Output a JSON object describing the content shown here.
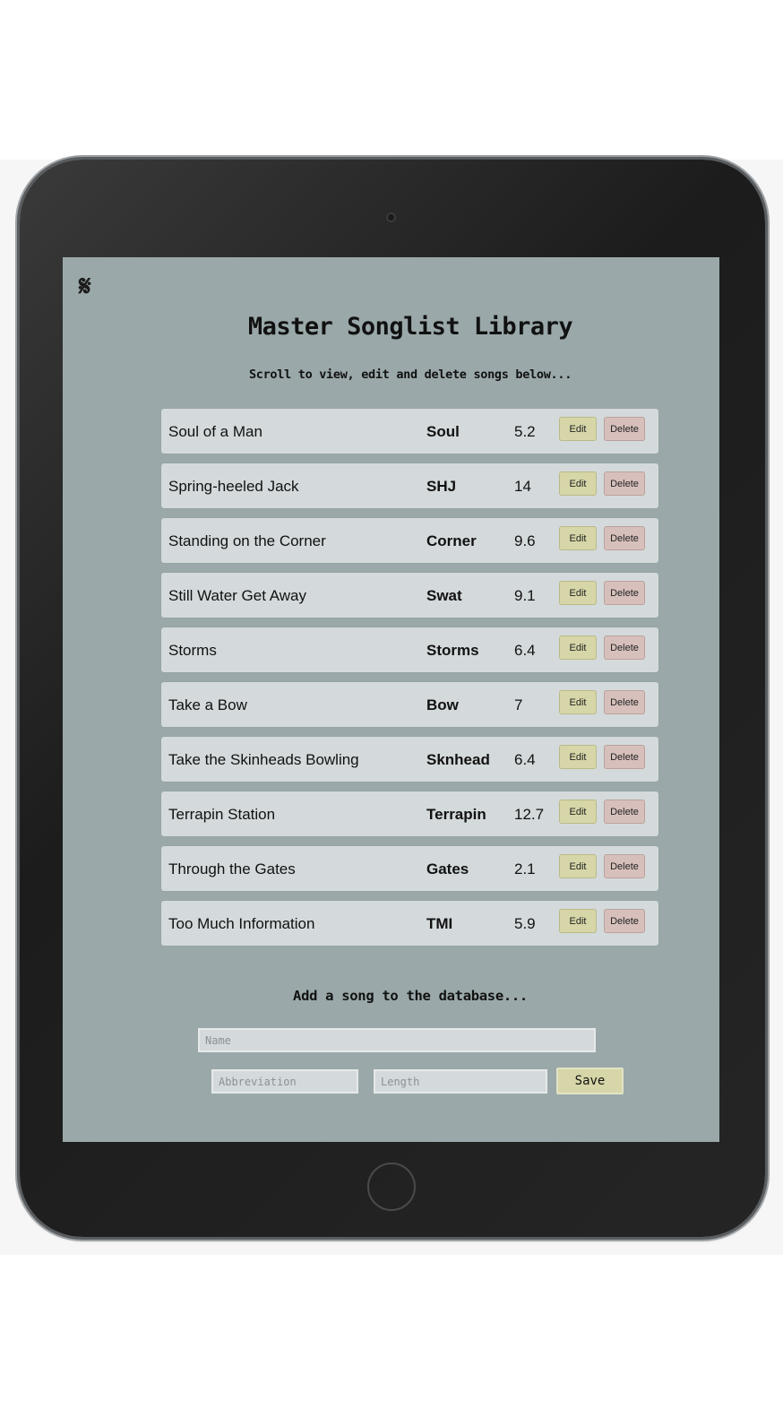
{
  "app": {
    "logo_glyph": "𝄋",
    "title": "Master Songlist Library",
    "subtitle": "Scroll to view, edit and delete songs below..."
  },
  "songs": [
    {
      "name": "Soul of a Man",
      "abbreviation": "Soul",
      "length": "5.2",
      "edit_label": "Edit",
      "delete_label": "Delete"
    },
    {
      "name": "Spring-heeled Jack",
      "abbreviation": "SHJ",
      "length": "14",
      "edit_label": "Edit",
      "delete_label": "Delete"
    },
    {
      "name": "Standing on the Corner",
      "abbreviation": "Corner",
      "length": "9.6",
      "edit_label": "Edit",
      "delete_label": "Delete"
    },
    {
      "name": "Still Water Get Away",
      "abbreviation": "Swat",
      "length": "9.1",
      "edit_label": "Edit",
      "delete_label": "Delete"
    },
    {
      "name": "Storms",
      "abbreviation": "Storms",
      "length": "6.4",
      "edit_label": "Edit",
      "delete_label": "Delete"
    },
    {
      "name": "Take a Bow",
      "abbreviation": "Bow",
      "length": "7",
      "edit_label": "Edit",
      "delete_label": "Delete"
    },
    {
      "name": "Take the Skinheads Bowling",
      "abbreviation": "Sknhead",
      "length": "6.4",
      "edit_label": "Edit",
      "delete_label": "Delete"
    },
    {
      "name": "Terrapin Station",
      "abbreviation": "Terrapin",
      "length": "12.7",
      "edit_label": "Edit",
      "delete_label": "Delete"
    },
    {
      "name": "Through the Gates",
      "abbreviation": "Gates",
      "length": "2.1",
      "edit_label": "Edit",
      "delete_label": "Delete"
    },
    {
      "name": "Too Much Information",
      "abbreviation": "TMI",
      "length": "5.9",
      "edit_label": "Edit",
      "delete_label": "Delete"
    }
  ],
  "add_form": {
    "heading": "Add a song to the database...",
    "name_placeholder": "Name",
    "abbreviation_placeholder": "Abbreviation",
    "length_placeholder": "Length",
    "save_label": "Save"
  },
  "colors": {
    "screen_bg": "#9aa8a9",
    "row_bg": "#d4dadb",
    "edit_bg": "#d6d6a8",
    "delete_bg": "#d7c0bc",
    "device_body": "#222222"
  },
  "icons": {
    "logo": "segno-icon",
    "camera": "camera-icon",
    "home": "home-button-icon"
  }
}
